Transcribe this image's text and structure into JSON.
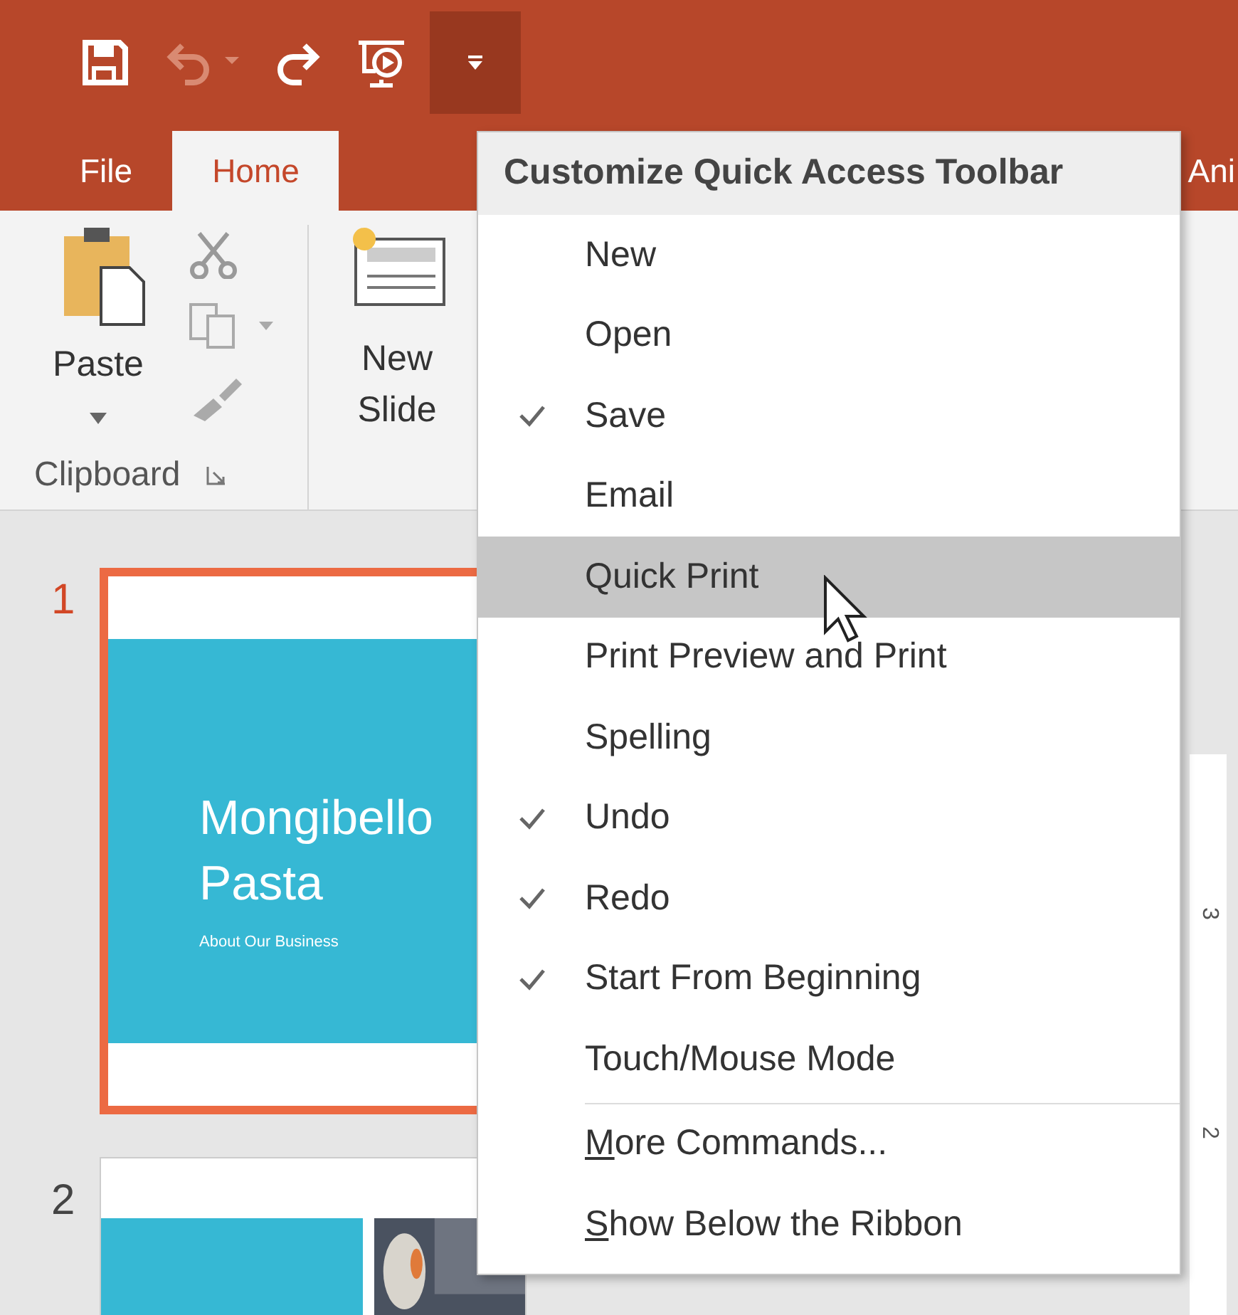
{
  "quick_access": {
    "buttons": [
      {
        "kind": "save",
        "disabled": false
      },
      {
        "kind": "undo",
        "disabled": true
      },
      {
        "kind": "redo",
        "disabled": false
      },
      {
        "kind": "present",
        "disabled": false
      }
    ],
    "customize_selected": true
  },
  "tabs": [
    {
      "label": "File",
      "selected": false
    },
    {
      "label": "Home",
      "selected": true
    },
    {
      "label": "Ani",
      "selected": false
    }
  ],
  "ribbon": {
    "paste": "Paste",
    "group_label": "Clipboard",
    "new_slide": "New Slide"
  },
  "slides": [
    {
      "number": "1",
      "selected": true,
      "title_lines": [
        "Mongibello",
        "Pasta"
      ],
      "subtitle": "About Our Business"
    },
    {
      "number": "2",
      "selected": false
    }
  ],
  "menu": {
    "title": "Customize Quick Access Toolbar",
    "items": [
      {
        "label": "New",
        "checked": false,
        "selected": false
      },
      {
        "label": "Open",
        "checked": false,
        "selected": false
      },
      {
        "label": "Save",
        "checked": true,
        "selected": false
      },
      {
        "label": "Email",
        "checked": false,
        "selected": false
      },
      {
        "label": "Quick Print",
        "checked": false,
        "selected": true
      },
      {
        "label": "Print Preview and Print",
        "checked": false,
        "selected": false
      },
      {
        "label": "Spelling",
        "checked": false,
        "selected": false
      },
      {
        "label": "Undo",
        "checked": true,
        "selected": false
      },
      {
        "label": "Redo",
        "checked": true,
        "selected": false
      },
      {
        "label": "Start From Beginning",
        "checked": true,
        "selected": false
      },
      {
        "label": "Touch/Mouse Mode",
        "checked": false,
        "selected": false
      }
    ],
    "commands": [
      {
        "label": "More Commands...",
        "underline_first": true
      },
      {
        "label": "Show Below the Ribbon",
        "underline_first": true
      }
    ]
  },
  "ruler": {
    "labels": [
      "3",
      "2"
    ]
  }
}
